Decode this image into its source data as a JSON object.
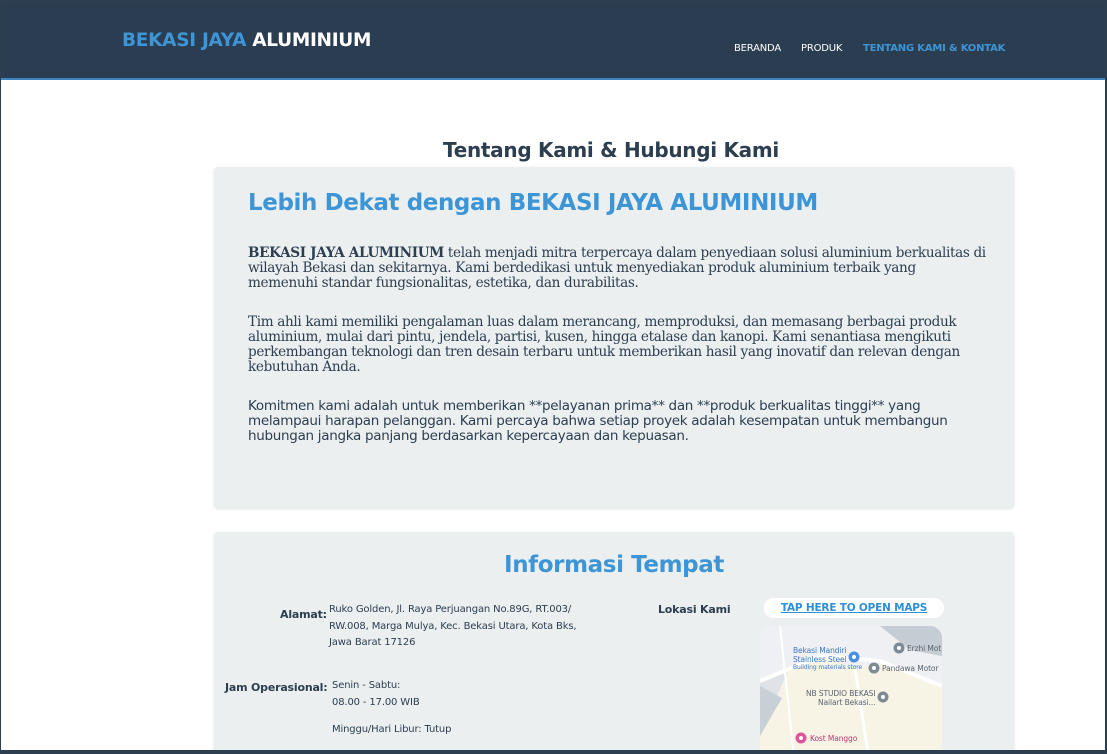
{
  "header": {
    "brand_part1": "BEKASI JAYA",
    "brand_part2": "ALUMINIUM",
    "nav": [
      "BERANDA",
      "PRODUK",
      "TENTANG KAMI & KONTAK"
    ],
    "active_nav": "TENTANG KAMI & KONTAK"
  },
  "page_title": "Tentang Kami & Hubungi Kami",
  "about": {
    "heading": "Lebih Dekat dengan BEKASI JAYA ALUMINIUM",
    "p1_strong": "BEKASI JAYA ALUMINIUM",
    "p1_rest": " telah menjadi mitra terpercaya dalam penyediaan solusi aluminium berkualitas di wilayah Bekasi dan sekitarnya. Kami berdedikasi untuk menyediakan produk aluminium terbaik yang memenuhi standar fungsionalitas, estetika, dan durabilitas.",
    "p2": "Tim ahli kami memiliki pengalaman luas dalam merancang, memproduksi, dan memasang berbagai produk aluminium, mulai dari pintu, jendela, partisi, kusen, hingga etalase dan kanopi. Kami senantiasa mengikuti perkembangan teknologi dan tren desain terbaru untuk memberikan hasil yang inovatif dan relevan dengan kebutuhan Anda.",
    "p3": "Komitmen kami adalah untuk memberikan **pelayanan prima** dan **produk berkualitas tinggi** yang melampaui harapan pelanggan. Kami percaya bahwa setiap proyek adalah kesempatan untuk membangun hubungan jangka panjang berdasarkan kepercayaan dan kepuasan."
  },
  "info": {
    "heading": "Informasi Tempat",
    "address_label": "Alamat:",
    "address_lines": [
      "Ruko Golden, Jl. Raya Perjuangan No.89G, RT.003/",
      "RW.008, Marga Mulya, Kec. Bekasi Utara, Kota Bks,",
      "Jawa Barat 17126"
    ],
    "hours_label": "Jam Operasional:",
    "hours_line1": "Senin - Sabtu:",
    "hours_line2": "08.00 - 17.00 WIB",
    "hours_line3": "Minggu/Hari Libur: Tutup",
    "location_label": "Lokasi Kami",
    "maps_button": "TAP HERE TO OPEN MAPS"
  },
  "map": {
    "place1_line1": "Bekasi Mandiri",
    "place1_line2": "Stainless Steel",
    "place1_line3": "Building materials store",
    "place2": "Erzhi Mot",
    "place3": "Pandawa Motor",
    "place4_line1": "NB STUDIO BEKASI",
    "place4_line2": "Nailart Bekasi...",
    "place5": "Kost Manggo"
  },
  "colors": {
    "header_bg": "#2b3d51",
    "accent": "#3d95d6",
    "text": "#2c3e50",
    "card_bg": "#ebeff0"
  }
}
